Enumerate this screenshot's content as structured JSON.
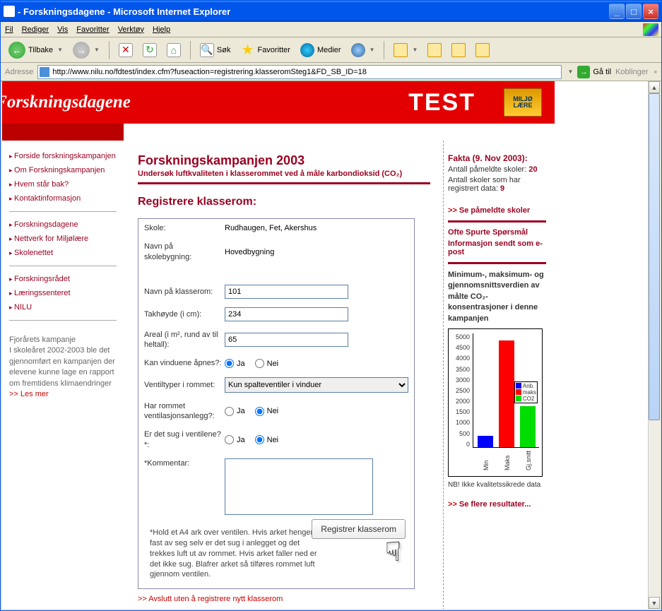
{
  "window": {
    "title": " - Forskningsdagene - Microsoft Internet Explorer"
  },
  "menubar": {
    "file": "Fil",
    "edit": "Rediger",
    "view": "Vis",
    "favorites": "Favoritter",
    "tools": "Verktøy",
    "help": "Hjelp"
  },
  "toolbar": {
    "back": "Tilbake",
    "search": "Søk",
    "favorites": "Favoritter",
    "media": "Medier"
  },
  "addressbar": {
    "label": "Adresse",
    "url": "http://www.nilu.no/fdtest/index.cfm?fuseaction=registrering.klasseromSteg1&FD_SB_ID=18",
    "go": "Gå til",
    "links": "Koblinger"
  },
  "banner": {
    "logo": "Forskningsdagene",
    "test": "TEST",
    "badge": "MILJØ\nLÆRE"
  },
  "leftnav": {
    "group1": [
      "Forside forskningskampanjen",
      "Om Forskningskampanjen",
      "Hvem står bak?",
      "Kontaktinformasjon"
    ],
    "group2": [
      "Forskningsdagene",
      "Nettverk for Miljølære",
      "Skolenettet"
    ],
    "group3": [
      "Forskningsrådet",
      "Læringssenteret",
      "NILU"
    ],
    "promo_title": "Fjorårets kampanje",
    "promo_text": "I skoleåret 2002-2003 ble det gjennomført en kampanjen der elevene kunne lage en rapport om fremtidens klimaendringer",
    "promo_more": ">> Les mer"
  },
  "main": {
    "title": "Forskningskampanjen 2003",
    "subtitle": "Undersøk luftkvaliteten i klasserommet ved å måle karbondioksid (CO₂)",
    "section": "Registrere klasserom:",
    "labels": {
      "school": "Skole:",
      "building": "Navn på skolebygning:",
      "classroom": "Navn på klasserom:",
      "ceiling": "Takhøyde (i cm):",
      "area": "Areal (i m², rund av til heltall):",
      "windows": "Kan vinduene åpnes?:",
      "venttype": "Ventiltyper i rommet:",
      "hasvent": "Har rommet ventilasjonsanlegg?:",
      "suction": "Er det sug i ventilene?*:",
      "comment": "*Kommentar:"
    },
    "values": {
      "school": "Rudhaugen, Fet, Akershus",
      "building": "Hovedbygning",
      "classroom": "101",
      "ceiling": "234",
      "area": "65",
      "windows": "Ja",
      "venttype": "Kun spalteventiler i vinduer",
      "hasvent": "Nei",
      "suction": "Nei",
      "comment": ""
    },
    "radio": {
      "yes": "Ja",
      "no": "Nei"
    },
    "note": "*Hold et A4 ark over ventilen. Hvis arket henger fast av seg selv er det sug i anlegget og det trekkes luft ut av rommet. Hvis arket faller ned er det ikke sug. Blafrer arket så tilføres rommet luft gjennom ventilen.",
    "submit": "Registrer klasserom",
    "cancel": ">> Avslutt uten å registrere nytt klasserom"
  },
  "right": {
    "facts_title": "Fakta (9. Nov 2003):",
    "fact1_label": "Antall påmeldte skoler: ",
    "fact1_val": "20",
    "fact2_label": "Antall skoler som har registrert data: ",
    "fact2_val": "9",
    "link_schools": "Se påmeldte skoler",
    "faq": "Ofte Spurte Spørsmål",
    "info_email": "Informasjon sendt som e-post",
    "stats_text": "Minimum-, maksimum- og gjennomsnittsverdien av målte CO₂-konsentrasjoner i denne kampanjen",
    "nb": "NB! Ikke kvalitetssikrede data",
    "more_results": "Se flere resultater..."
  },
  "chart_data": {
    "type": "bar",
    "categories": [
      "Min",
      "Maks",
      "Gj.snitt"
    ],
    "values": [
      500,
      4700,
      1800
    ],
    "series_names": [
      "Anb.",
      "maks",
      "CO2"
    ],
    "colors": [
      "#0000ff",
      "#ff0000",
      "#00dd00"
    ],
    "ylim": [
      0,
      5000
    ],
    "yticks": [
      0,
      500,
      1000,
      1500,
      2000,
      2500,
      3000,
      3500,
      4000,
      4500,
      5000
    ],
    "title": "",
    "xlabel": "",
    "ylabel": ""
  }
}
